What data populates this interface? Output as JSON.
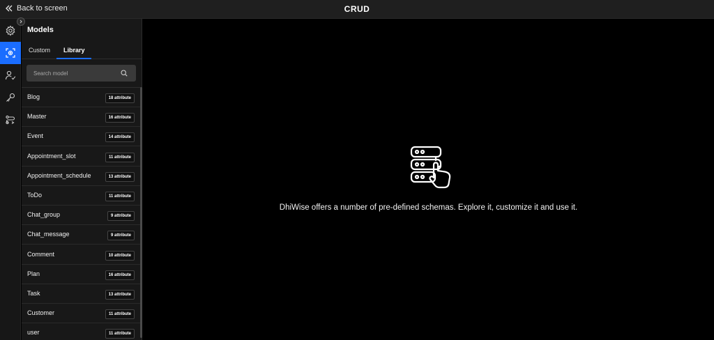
{
  "topbar": {
    "back_label": "Back to screen",
    "title": "CRUD"
  },
  "rail": {
    "items": [
      "gear-icon",
      "model-icon",
      "user-role-icon",
      "key-icon",
      "workflow-icon"
    ],
    "active_index": 1,
    "accent": "#1a6dff"
  },
  "panel": {
    "title": "Models",
    "tabs": [
      {
        "label": "Custom"
      },
      {
        "label": "Library"
      }
    ],
    "active_tab": "Library",
    "search": {
      "placeholder": "Search model",
      "value": ""
    },
    "models": [
      {
        "name": "Blog",
        "attributes": "18 attribute"
      },
      {
        "name": "Master",
        "attributes": "16 attribute"
      },
      {
        "name": "Event",
        "attributes": "14 attribute"
      },
      {
        "name": "Appointment_slot",
        "attributes": "11 attribute"
      },
      {
        "name": "Appointment_schedule",
        "attributes": "13 attribute"
      },
      {
        "name": "ToDo",
        "attributes": "11 attribute"
      },
      {
        "name": "Chat_group",
        "attributes": "9 attribute"
      },
      {
        "name": "Chat_message",
        "attributes": "9 attribute"
      },
      {
        "name": "Comment",
        "attributes": "10 attribute"
      },
      {
        "name": "Plan",
        "attributes": "16 attribute"
      },
      {
        "name": "Task",
        "attributes": "13 attribute"
      },
      {
        "name": "Customer",
        "attributes": "11 attribute"
      },
      {
        "name": "user",
        "attributes": "11 attribute"
      }
    ]
  },
  "main": {
    "message": "DhiWise offers a number of pre-defined schemas. Explore it, customize it and use it.",
    "icon": "database-pointer-icon"
  }
}
